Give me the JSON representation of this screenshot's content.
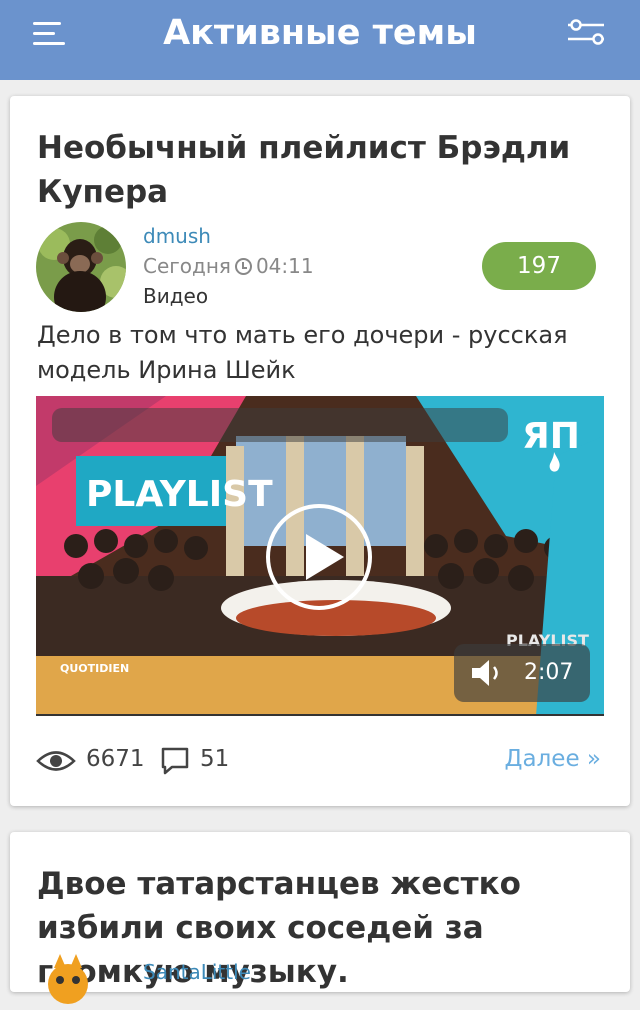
{
  "header": {
    "title": "Активные темы",
    "menu_icon": "hamburger-menu-icon",
    "filter_icon": "filter-sliders-icon"
  },
  "posts": [
    {
      "title": "Необычный плейлист Брэдли Купера",
      "author": "dmush",
      "date": "Сегодня",
      "time": "04:11",
      "category": "Видео",
      "rating": "197",
      "summary": "Дело в том что мать его дочери - русская модель Ирина Шейк",
      "video": {
        "duration": "2:07",
        "overlay_text": [
          "PLAYLIST",
          "QUOTIDIEN",
          "PLAYLIST"
        ],
        "channel_logo": "ЯП"
      },
      "views": "6671",
      "comments": "51",
      "more_label": "Далее »"
    },
    {
      "title": "Двое татарстанцев жестко избили своих соседей за громкую музыку.",
      "author": "SantaLittle"
    }
  ],
  "colors": {
    "header_bg": "#6b93cd",
    "badge_bg": "#7aad4b",
    "author_link": "#3d8ab8",
    "more_link": "#6aaee0"
  }
}
